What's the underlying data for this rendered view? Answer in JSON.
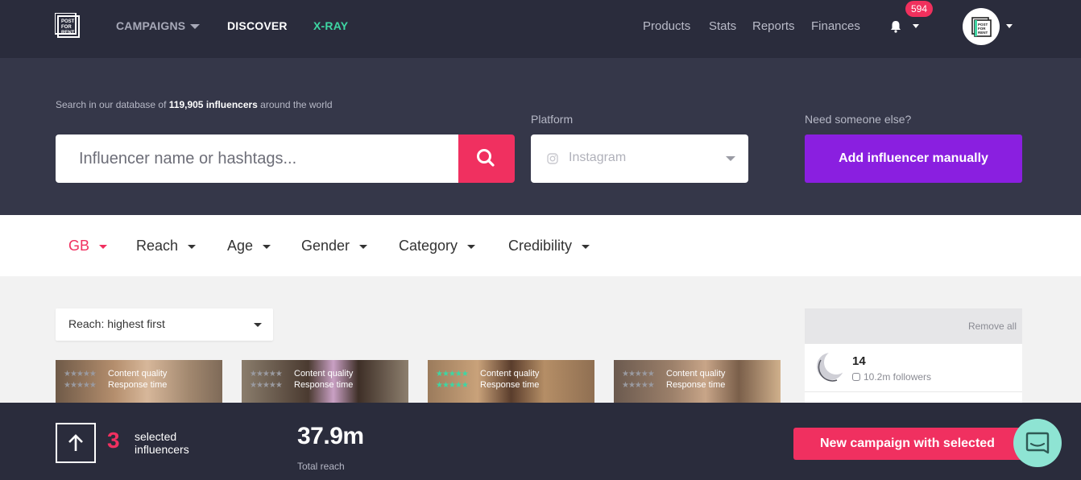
{
  "nav": {
    "logo_text": "POST FOR RENT",
    "campaigns": "CAMPAIGNS",
    "discover": "DISCOVER",
    "xray": "X-RAY",
    "products": "Products",
    "stats": "Stats",
    "reports": "Reports",
    "finances": "Finances",
    "notifications_count": "594",
    "icons": {
      "bell": "bell-icon",
      "caret": "chevron-down-icon"
    }
  },
  "search": {
    "intro_prefix": "Search in our database of ",
    "intro_count": "119,905 influencers",
    "intro_suffix": " around the world",
    "placeholder": "Influencer name or hashtags...",
    "platform_label": "Platform",
    "platform_value": "Instagram",
    "else_label": "Need someone else?",
    "add_manually": "Add influencer manually"
  },
  "filters": [
    {
      "label": "GB",
      "active": true
    },
    {
      "label": "Reach",
      "active": false
    },
    {
      "label": "Age",
      "active": false
    },
    {
      "label": "Gender",
      "active": false
    },
    {
      "label": "Category",
      "active": false
    },
    {
      "label": "Credibility",
      "active": false
    }
  ],
  "sort": {
    "value": "Reach: highest first"
  },
  "cards": [
    {
      "content_quality": "Content quality",
      "response_time": "Response time",
      "stars": "★★★★★",
      "stars_color": "#9a9aa0"
    },
    {
      "content_quality": "Content quality",
      "response_time": "Response time",
      "stars": "★★★★★",
      "stars_color": "#9a9aa0"
    },
    {
      "content_quality": "Content quality",
      "response_time": "Response time",
      "stars": "★★★★★",
      "stars_color": "#3ed6a3"
    },
    {
      "content_quality": "Content quality",
      "response_time": "Response time",
      "stars": "★★★★★",
      "stars_color": "#9a9aa0"
    }
  ],
  "selected_panel": {
    "remove_all": "Remove all",
    "items": [
      {
        "name": "14",
        "followers": "10.2m followers"
      }
    ]
  },
  "bottom": {
    "selected_count": "3",
    "selected_label": "selected influencers",
    "total_reach_value": "37.9m",
    "total_reach_label": "Total reach",
    "new_campaign": "New campaign with selected"
  },
  "colors": {
    "brand_pink": "#f03060",
    "brand_purple": "#8a1fe0",
    "brand_green": "#3ed6a3",
    "dark_bg": "#2a2c3c"
  }
}
